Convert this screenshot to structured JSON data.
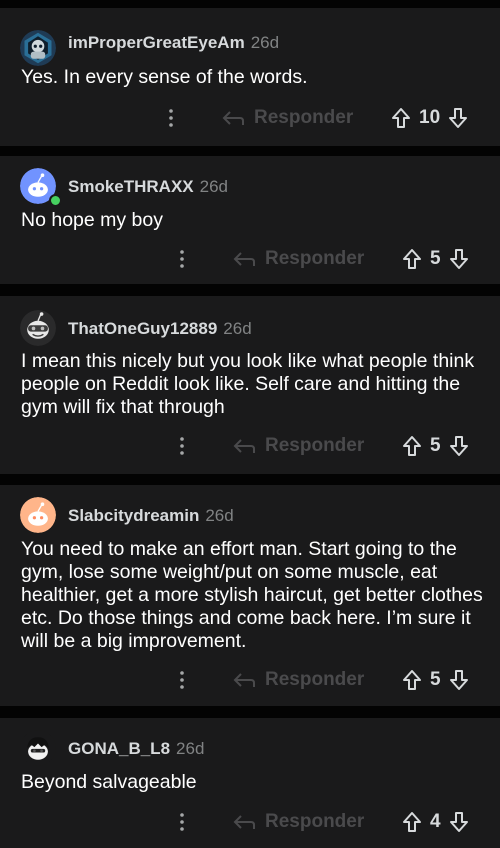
{
  "comments": [
    {
      "author": "imProperGreatEyeAm",
      "age": "26d",
      "avatar_icon": "dark-blue-hexagon-avatar-icon",
      "body": "Yes. In every sense of the words.",
      "reply_label": "Responder",
      "score": "10"
    },
    {
      "author": "SmokeTHRAXX",
      "age": "26d",
      "avatar_icon": "periwinkle-snoo-avatar-icon",
      "online": true,
      "body": "No hope my boy",
      "reply_label": "Responder",
      "score": "5"
    },
    {
      "author": "ThatOneGuy12889",
      "age": "26d",
      "avatar_icon": "gray-snoo-avatar-icon",
      "body": "I mean this nicely but you look like what people think people on Reddit look like. Self care and hitting the gym will fix that through",
      "reply_label": "Responder",
      "score": "5"
    },
    {
      "author": "Slabcitydreamin",
      "age": "26d",
      "avatar_icon": "orange-snoo-avatar-icon",
      "body": "You need to make an effort man. Start going to the gym, lose some weight/put on some muscle, eat healthier, get a more stylish haircut, get better clothes etc. Do those things and come back here. I’m sure it will be a big improvement.",
      "reply_label": "Responder",
      "score": "5"
    },
    {
      "author": "GONA_B_L8",
      "age": "26d",
      "avatar_icon": "black-hair-snoo-avatar-icon",
      "body": "Beyond salvageable",
      "reply_label": "Responder",
      "score": "4"
    }
  ],
  "colors": {
    "background": "#030303",
    "card": "#1a1a1b",
    "text": "#ffffff",
    "author": "#d7dadc",
    "meta": "#818384",
    "reply_muted": "#4a4a4c",
    "online": "#46d160"
  }
}
